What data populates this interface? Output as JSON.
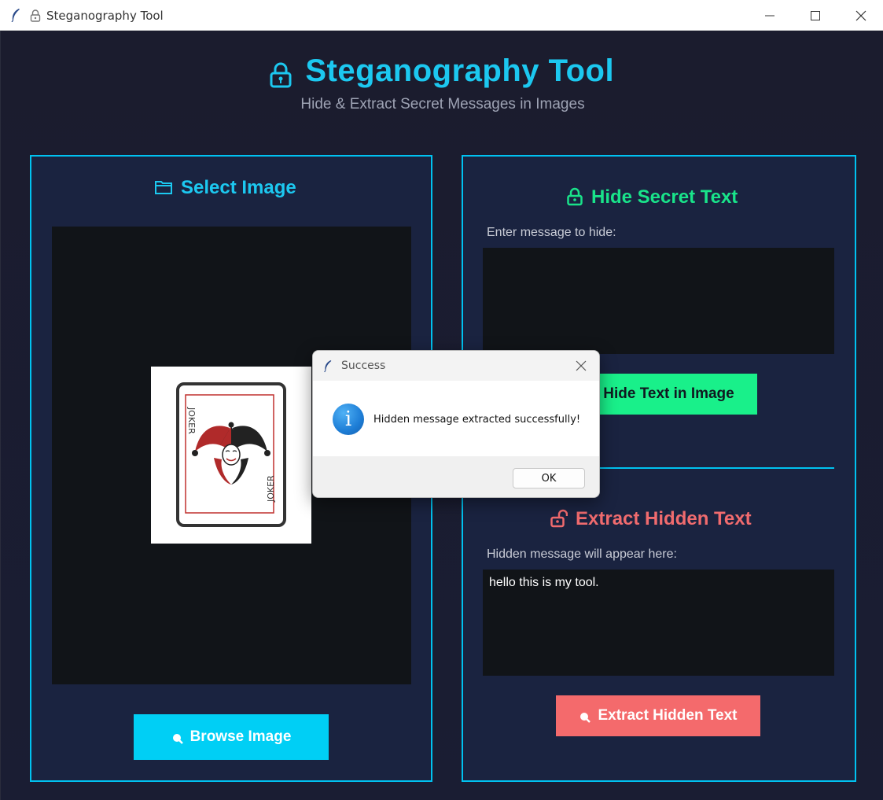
{
  "window": {
    "title": "Steganography Tool",
    "controls": [
      "minimize-icon",
      "maximize-icon",
      "close-icon"
    ]
  },
  "header": {
    "title": "Steganography Tool",
    "subtitle": "Hide & Extract Secret Messages in Images"
  },
  "left_panel": {
    "heading": "Select Image",
    "heading_icon": "folder-icon",
    "browse_button": "Browse Image",
    "preview_image": "joker-card-image"
  },
  "right_panel": {
    "hide": {
      "heading": "Hide Secret Text",
      "heading_icon": "lock-icon",
      "input_label": "Enter message to hide:",
      "input_value": "",
      "button": "Hide Text in Image"
    },
    "extract": {
      "heading": "Extract Hidden Text",
      "heading_icon": "unlock-icon",
      "output_label": "Hidden message will appear here:",
      "output_value": "hello this is my tool.",
      "button": "Extract Hidden Text"
    }
  },
  "dialog": {
    "title": "Success",
    "message": "Hidden message extracted successfully!",
    "ok_label": "OK",
    "icon": "info-icon"
  },
  "colors": {
    "accent_cyan": "#00cff5",
    "accent_green": "#19f08a",
    "accent_red": "#f46a6c",
    "background": "#1b1c2e",
    "panel": "#1a2340"
  }
}
